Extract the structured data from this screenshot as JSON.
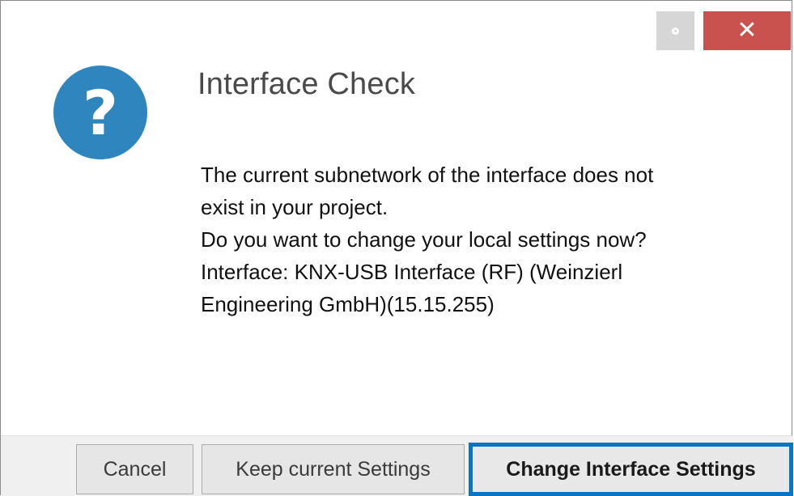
{
  "window": {
    "settings_icon": "gear-icon",
    "close_symbol": "✕",
    "close_color": "#c9514e"
  },
  "dialog": {
    "icon_glyph": "?",
    "icon_color": "#2f86bf",
    "title": "Interface Check",
    "message_lines": [
      "The current subnetwork of the interface does not",
      "exist in your project.",
      "Do you want to change your local settings now?",
      "Interface: KNX-USB Interface (RF) (Weinzierl",
      "Engineering GmbH)(15.15.255)"
    ]
  },
  "buttons": {
    "cancel": "Cancel",
    "keep": "Keep current Settings",
    "change": "Change Interface Settings",
    "focus_color": "#0a74c4"
  }
}
